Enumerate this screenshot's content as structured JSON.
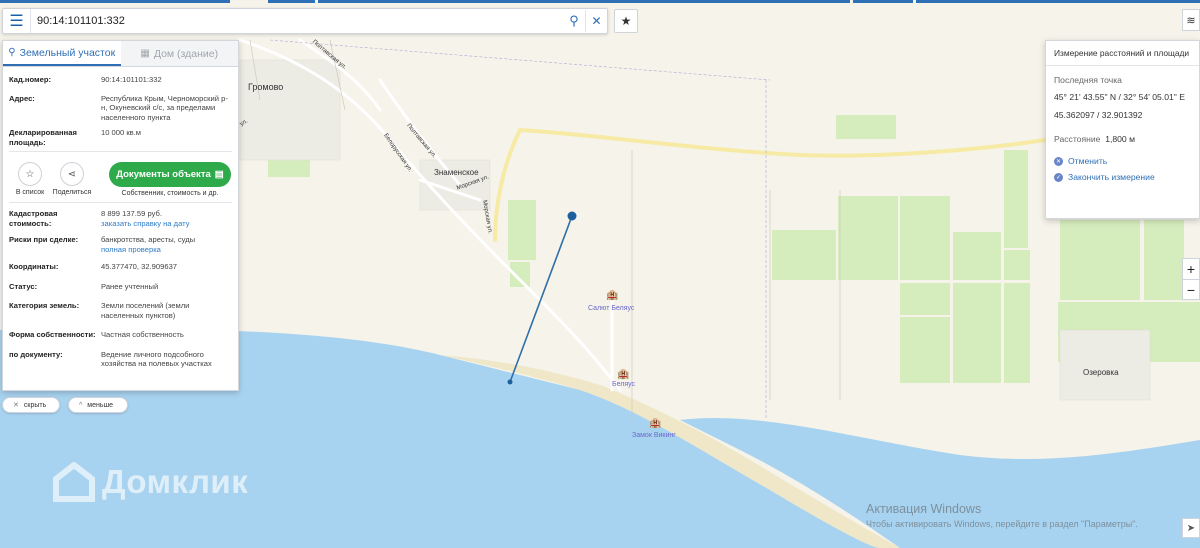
{
  "search": {
    "value": "90:14:101101:332",
    "menu_icon": "menu-icon",
    "search_icon": "search-icon",
    "clear_icon": "close-icon"
  },
  "favorites_icon": "star-icon",
  "tabs": [
    {
      "label": "Земельный участок",
      "icon": "land-plot-icon",
      "active": true
    },
    {
      "label": "Дом (здание)",
      "icon": "building-icon",
      "active": false
    }
  ],
  "details": {
    "cadastral_label": "Кад.номер:",
    "cadastral_value": "90:14:101101:332",
    "address_label": "Адрес:",
    "address_value": "Республика Крым, Черноморский р-н, Окуневский с/с, за пределами населенного пункта",
    "area_label": "Декларированная площадь:",
    "area_value": "10 000 кв.м"
  },
  "actions": {
    "save_label": "В список",
    "share_label": "Поделиться",
    "docs_button": "Документы объекта",
    "docs_sub": "Собственник, стоимость и др."
  },
  "info": {
    "cost_label": "Кадастровая стоимость:",
    "cost_value": "8 899 137.59 руб.",
    "cost_link": "заказать справку на дату",
    "risks_label": "Риски при сделке:",
    "risks_value": "банкротства, аресты, суды",
    "risks_link": "полная проверка",
    "coords_label": "Координаты:",
    "coords_value": "45.377470, 32.909637",
    "status_label": "Статус:",
    "status_value": "Ранее учтенный",
    "category_label": "Категория земель:",
    "category_value": "Земли поселений (земли населенных пунктов)",
    "ownership_label": "Форма собственности:",
    "ownership_value": "Частная собственность",
    "doc_label": "по документу:",
    "doc_value": "Ведение личного подсобного хозяйства на полевых участках"
  },
  "pills": {
    "hide": "скрыть",
    "less": "меньше"
  },
  "measure": {
    "title": "Измерение расстояний и площади",
    "last_point_label": "Последняя точка",
    "dms": "45° 21' 43.55\" N / 32° 54' 05.01\" E",
    "decimal": "45.362097 / 32.901392",
    "distance_label": "Расстояние",
    "distance_value": "1,800 м",
    "cancel": "Отменить",
    "finish": "Закончить измерение"
  },
  "map_labels": {
    "gromovo": "Громово",
    "znamenskoe": "Знаменское",
    "ozerovka": "Озеровка",
    "poltavskaya1": "Полтавская ул.",
    "poltavskaya2": "Полтавская ул.",
    "belorusskaya": "Белорусская ул.",
    "morskaya1": "Морская ул.",
    "morskaya2": "Морская ул.",
    "street_ul": "ул."
  },
  "poi": {
    "salyut": "Салют Беляус",
    "belyaus": "Беляус",
    "zamok": "Замок Викинг"
  },
  "watermark": {
    "brand": "Домклик",
    "win_title": "Активация Windows",
    "win_sub": "Чтобы активировать Windows, перейдите в раздел \"Параметры\"."
  },
  "colors": {
    "accent": "#2f6fb5",
    "green_button": "#2eaa4b",
    "sea": "#a8d3f0",
    "fields": "#d5ecbd",
    "land": "#f5f3ea"
  }
}
